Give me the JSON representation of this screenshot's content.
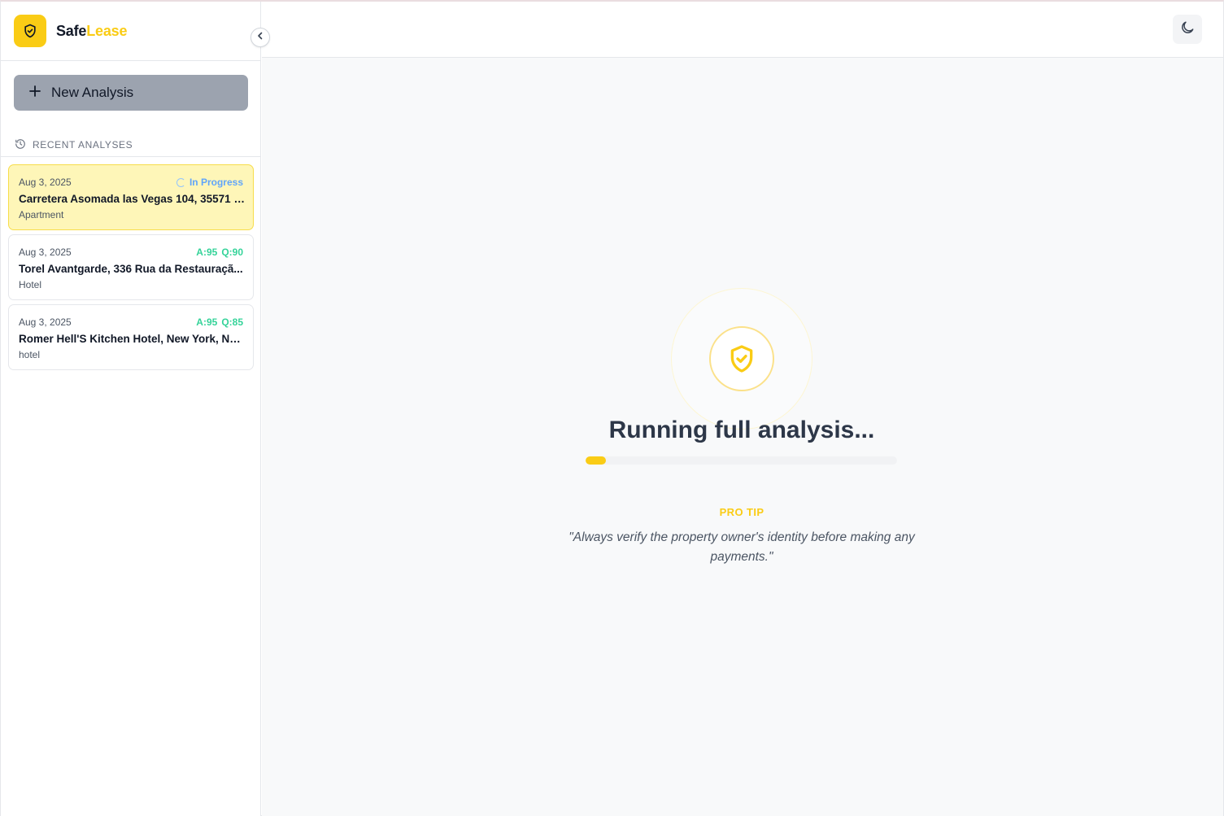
{
  "brand": {
    "name_part1": "Safe",
    "name_part2": "Lease",
    "logo_icon": "shield-check-icon",
    "accent_color": "#facc15"
  },
  "sidebar": {
    "collapse_icon": "chevron-left-icon",
    "new_analysis_label": "New Analysis",
    "recent_header": "RECENT ANALYSES",
    "recent_icon": "history-icon",
    "items": [
      {
        "date": "Aug 3, 2025",
        "status": "In Progress",
        "title": "Carretera Asomada las Vegas 104, 35571 L...",
        "type": "Apartment",
        "active": true
      },
      {
        "date": "Aug 3, 2025",
        "score_a": "A:95",
        "score_q": "Q:90",
        "title": "Torel Avantgarde, 336 Rua da Restauraçã...",
        "type": "Hotel",
        "active": false
      },
      {
        "date": "Aug 3, 2025",
        "score_a": "A:95",
        "score_q": "Q:85",
        "title": "Romer Hell'S Kitchen Hotel, New York, Ne...",
        "type": "hotel",
        "active": false
      }
    ]
  },
  "topbar": {
    "theme_toggle_icon": "moon-icon"
  },
  "main": {
    "status_title": "Running full analysis...",
    "progress_fraction": 0.065,
    "tip_label": "PRO TIP",
    "tip_text": "\"Always verify the property owner's identity before making any payments.\""
  }
}
